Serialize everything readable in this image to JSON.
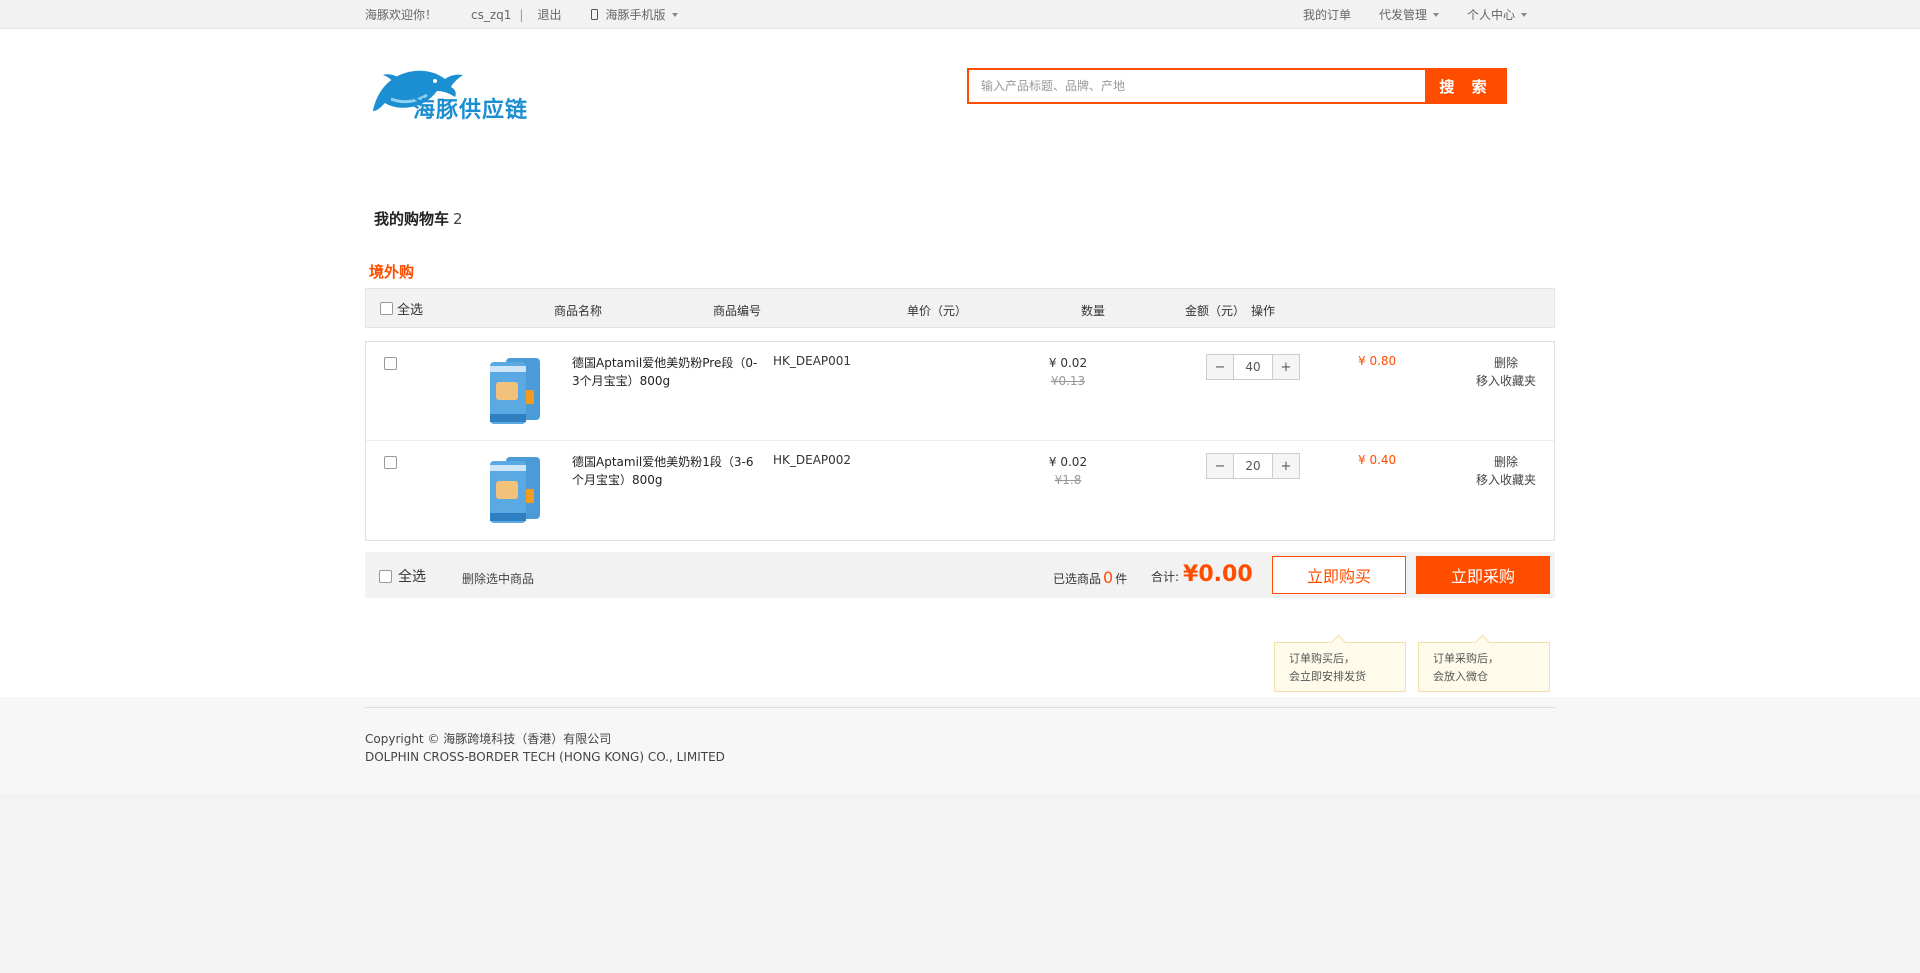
{
  "topbar": {
    "welcome": "海豚欢迎你！",
    "username": "cs_zq1",
    "logout": "退出",
    "mobile": "海豚手机版",
    "my_orders": "我的订单",
    "dropship": "代发管理",
    "personal_center": "个人中心"
  },
  "logo": {
    "text": "海豚供应链"
  },
  "search": {
    "placeholder": "输入产品标题、品牌、产地",
    "button": "搜 索"
  },
  "cart": {
    "title": "我的购物车",
    "count": "2",
    "tab": "境外购"
  },
  "table_head": {
    "select_all": "全选",
    "name": "商品名称",
    "code": "商品编号",
    "unit_price": "单价（元）",
    "quantity": "数量",
    "amount": "金额（元）",
    "action": "操作"
  },
  "items": [
    {
      "name": "德国Aptamil爱他美奶粉Pre段（0-3个月宝宝）800g",
      "code": "HK_DEAP001",
      "price": "¥ 0.02",
      "old_price": "¥0.13",
      "qty": "40",
      "amount": "¥ 0.80",
      "delete": "删除",
      "favorite": "移入收藏夹"
    },
    {
      "name": "德国Aptamil爱他美奶粉1段（3-6个月宝宝）800g",
      "code": "HK_DEAP002",
      "price": "¥ 0.02",
      "old_price": "¥1.8",
      "qty": "20",
      "amount": "¥ 0.40",
      "delete": "删除",
      "favorite": "移入收藏夹"
    }
  ],
  "footer_bar": {
    "select_all": "全选",
    "delete_selected": "删除选中商品",
    "selected_label": "已选商品",
    "selected_count": "0",
    "selected_unit": "件",
    "total_label": "合计:",
    "total": "¥0.00",
    "buy_now": "立即购买",
    "purchase_now": "立即采购"
  },
  "tips": {
    "buy_line1": "订单购买后，",
    "buy_line2": "会立即安排发货",
    "purchase_line1": "订单采购后，",
    "purchase_line2": "会放入微仓"
  },
  "site_footer": {
    "copyright": "Copyright ©  海豚跨境科技（香港）有限公司",
    "company_en": "DOLPHIN CROSS-BORDER TECH (HONG KONG) CO., LIMITED"
  },
  "colors": {
    "accent": "#ff4d00",
    "logo_blue": "#1b8fd1"
  }
}
